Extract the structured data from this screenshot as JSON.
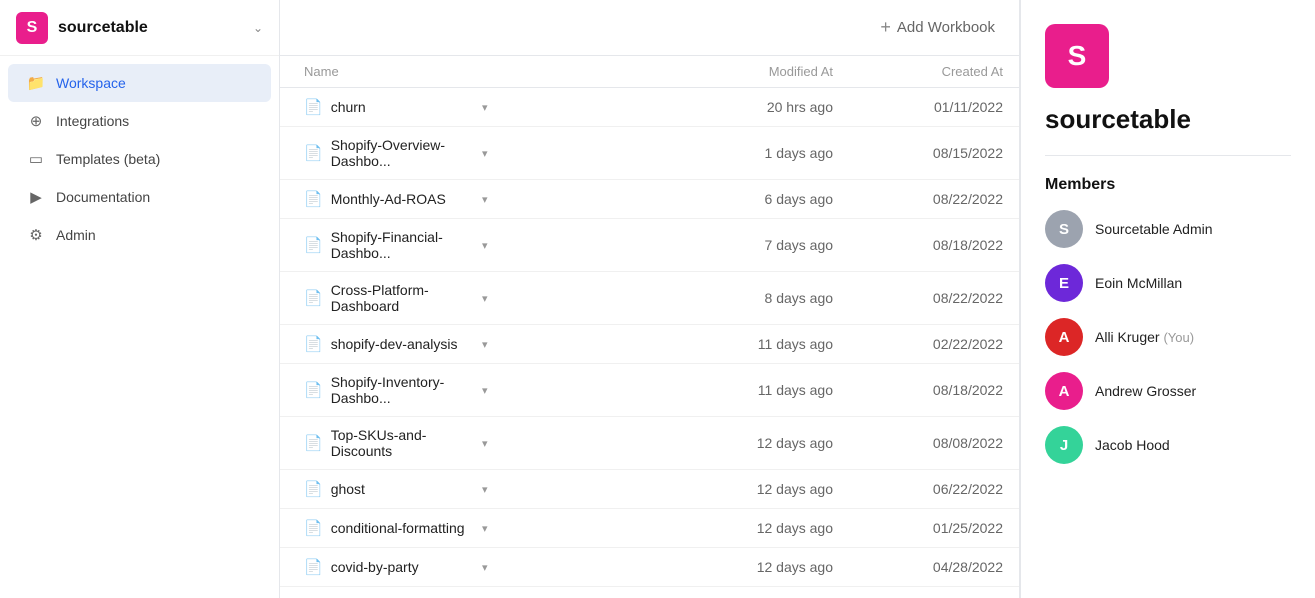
{
  "app": {
    "logo_letter": "S",
    "name": "sourcetable",
    "chevron": "∨"
  },
  "sidebar": {
    "items": [
      {
        "id": "workspace",
        "label": "Workspace",
        "icon": "📁",
        "active": true
      },
      {
        "id": "integrations",
        "label": "Integrations",
        "icon": "⊕",
        "active": false
      },
      {
        "id": "templates",
        "label": "Templates (beta)",
        "icon": "▭",
        "active": false
      },
      {
        "id": "documentation",
        "label": "Documentation",
        "icon": "▶",
        "active": false
      },
      {
        "id": "admin",
        "label": "Admin",
        "icon": "⚙",
        "active": false
      }
    ]
  },
  "main": {
    "add_workbook_label": "Add Workbook",
    "table": {
      "headers": [
        "Name",
        "Modified At",
        "Created At"
      ],
      "rows": [
        {
          "name": "churn",
          "modified": "20 hrs ago",
          "created": "01/11/2022"
        },
        {
          "name": "Shopify-Overview-Dashbo...",
          "modified": "1 days ago",
          "created": "08/15/2022"
        },
        {
          "name": "Monthly-Ad-ROAS",
          "modified": "6 days ago",
          "created": "08/22/2022"
        },
        {
          "name": "Shopify-Financial-Dashbo...",
          "modified": "7 days ago",
          "created": "08/18/2022"
        },
        {
          "name": "Cross-Platform-Dashboard",
          "modified": "8 days ago",
          "created": "08/22/2022"
        },
        {
          "name": "shopify-dev-analysis",
          "modified": "11 days ago",
          "created": "02/22/2022"
        },
        {
          "name": "Shopify-Inventory-Dashbo...",
          "modified": "11 days ago",
          "created": "08/18/2022"
        },
        {
          "name": "Top-SKUs-and-Discounts",
          "modified": "12 days ago",
          "created": "08/08/2022"
        },
        {
          "name": "ghost",
          "modified": "12 days ago",
          "created": "06/22/2022"
        },
        {
          "name": "conditional-formatting",
          "modified": "12 days ago",
          "created": "01/25/2022"
        },
        {
          "name": "covid-by-party",
          "modified": "12 days ago",
          "created": "04/28/2022"
        }
      ]
    }
  },
  "right_panel": {
    "logo_letter": "S",
    "workspace_name": "sourcetable",
    "members_label": "Members",
    "members": [
      {
        "name": "Sourcetable Admin",
        "initials": "S",
        "color": "#9ca3af",
        "you": false
      },
      {
        "name": "Eoin McMillan",
        "initials": "E",
        "color": "#6d28d9",
        "you": false
      },
      {
        "name": "Alli Kruger",
        "initials": "A",
        "color": "#dc2626",
        "you": true,
        "you_label": "(You)"
      },
      {
        "name": "Andrew Grosser",
        "initials": "A",
        "color": "#e91e8c",
        "you": false
      },
      {
        "name": "Jacob Hood",
        "initials": "J",
        "color": "#34d399",
        "you": false
      }
    ]
  }
}
